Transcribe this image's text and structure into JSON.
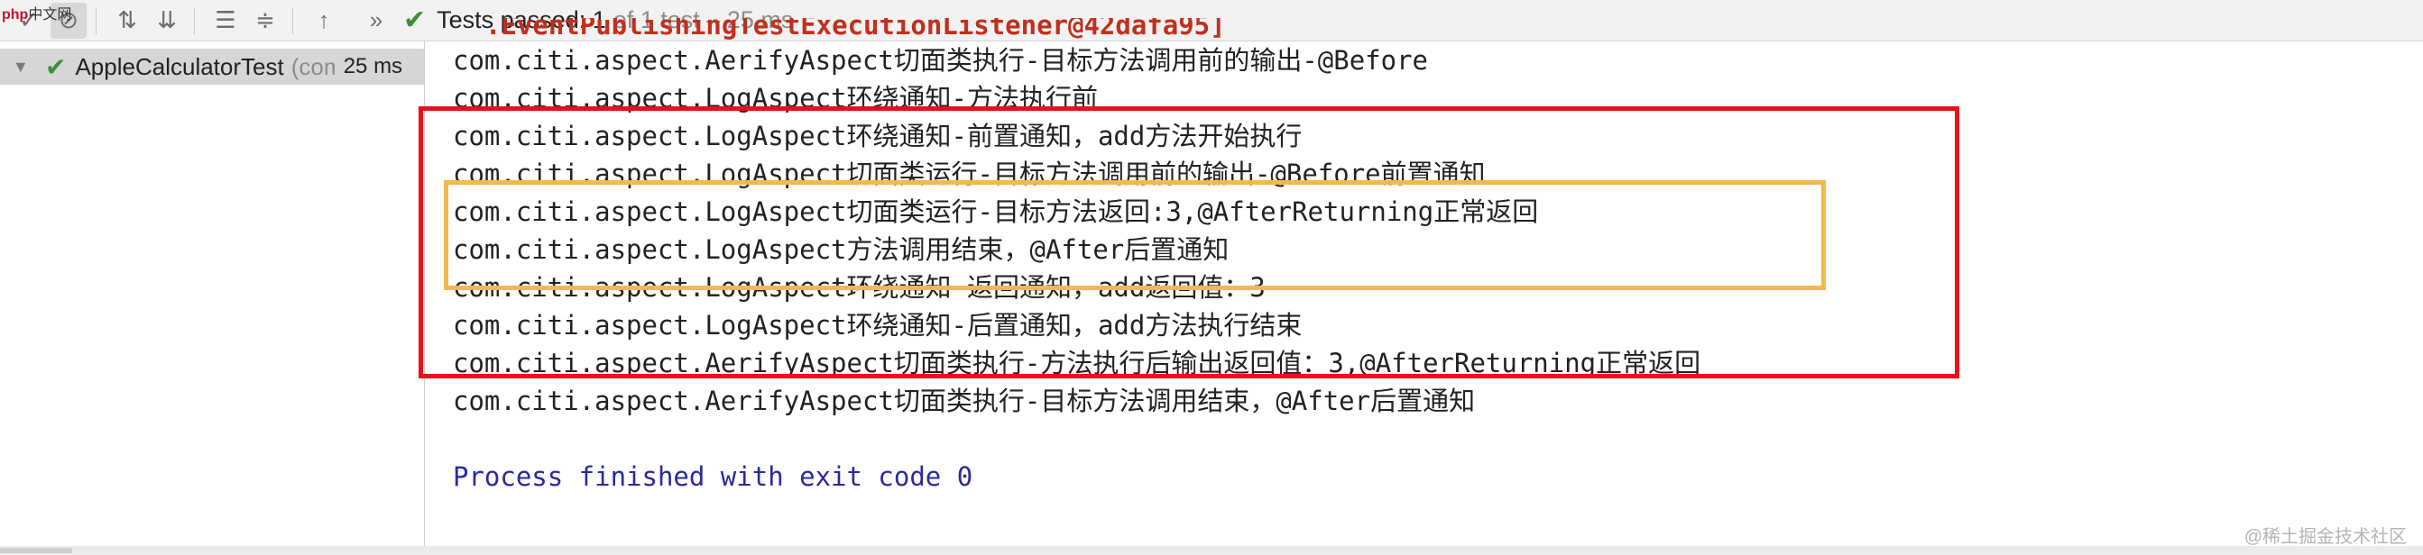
{
  "toolbar": {
    "status_main": "Tests passed: 1",
    "status_sub": "of 1 test – 25 ms",
    "icons": [
      "show-passed-icon",
      "show-ignored-icon",
      "sort-alpha-icon",
      "sort-duration-icon",
      "expand-all-icon",
      "collapse-all-icon",
      "up-arrow-icon",
      "more-icon"
    ]
  },
  "logo": {
    "brand": "php",
    "text": "中文网"
  },
  "tree": {
    "test_name": "AppleCalculatorTest",
    "test_class": "(com",
    "duration": "25 ms"
  },
  "console": {
    "lines": [
      ".EventPublishingTestExecutionListener@42dafa95]",
      "com.citi.aspect.AerifyAspect切面类执行-目标方法调用前的输出-@Before",
      "com.citi.aspect.LogAspect环绕通知-方法执行前",
      "com.citi.aspect.LogAspect环绕通知-前置通知，add方法开始执行",
      "com.citi.aspect.LogAspect切面类运行-目标方法调用前的输出-@Before前置通知",
      "com.citi.aspect.LogAspect切面类运行-目标方法返回:3,@AfterReturning正常返回",
      "com.citi.aspect.LogAspect方法调用结束，@After后置通知",
      "com.citi.aspect.LogAspect环绕通知-返回通知，add返回值：3",
      "com.citi.aspect.LogAspect环绕通知-后置通知，add方法执行结束",
      "com.citi.aspect.AerifyAspect切面类执行-方法执行后输出返回值：3,@AfterReturning正常返回",
      "com.citi.aspect.AerifyAspect切面类执行-目标方法调用结束，@After后置通知",
      "Process finished with exit code 0"
    ]
  },
  "watermark": "@稀土掘金技术社区",
  "colors": {
    "red_box": "#e8101a",
    "yellow_box": "#f2b94c",
    "pass_green": "#3d8f3d",
    "error_red": "#c0301e",
    "process_blue": "#2a2a9a"
  }
}
